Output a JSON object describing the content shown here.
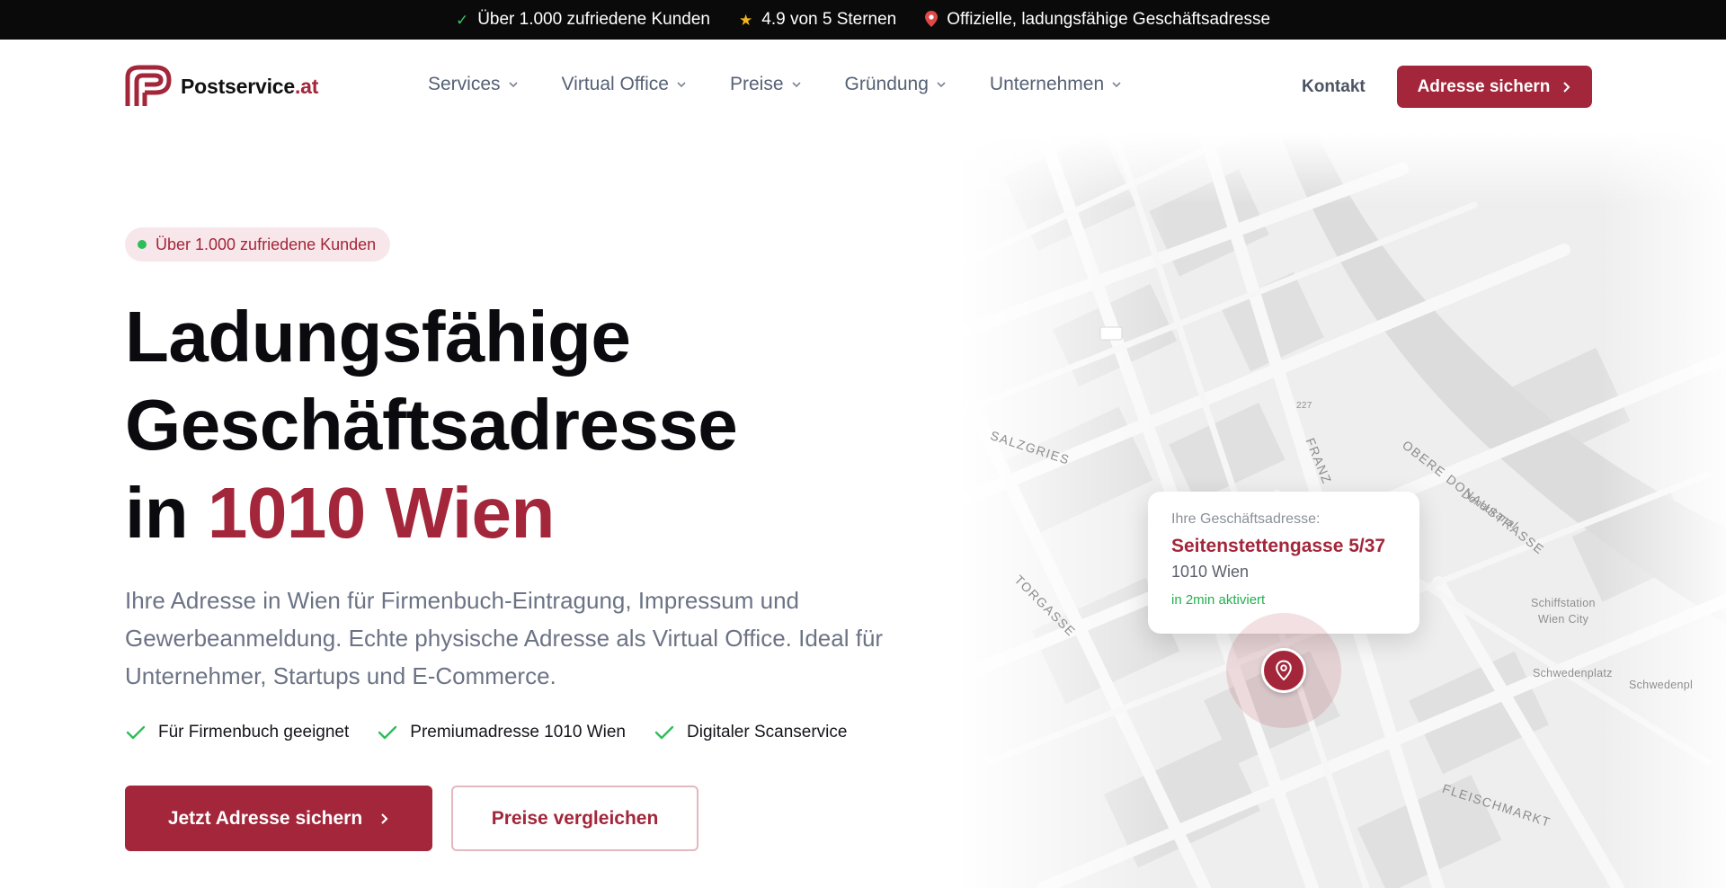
{
  "topbar": {
    "items": [
      {
        "icon": "check-icon",
        "text": "Über 1.000 zufriedene Kunden"
      },
      {
        "icon": "star-icon",
        "text": "4.9 von 5 Sternen"
      },
      {
        "icon": "pin-icon",
        "text": "Offizielle, ladungsfähige Geschäftsadresse"
      }
    ]
  },
  "header": {
    "logo": {
      "name": "Postservice",
      "tld": ".at"
    },
    "nav": [
      "Services",
      "Virtual Office",
      "Preise",
      "Gründung",
      "Unternehmen"
    ],
    "kontakt": "Kontakt",
    "cta": "Adresse sichern"
  },
  "hero": {
    "badge": "Über 1.000 zufriedene Kunden",
    "title_line1": "Ladungsfähige",
    "title_line2": "Geschäftsadresse",
    "title_line3_prefix": "in ",
    "title_line3_highlight": "1010 Wien",
    "description": "Ihre Adresse in Wien für Firmenbuch-Eintragung, Impressum und Gewerbeanmeldung. Echte physische Adresse als Virtual Office. Ideal für Unternehmer, Startups und E-Commerce.",
    "features": [
      "Für Firmenbuch geeignet",
      "Premiumadresse 1010 Wien",
      "Digitaler Scanservice"
    ],
    "primary_button": "Jetzt Adresse sichern",
    "secondary_button": "Preise vergleichen"
  },
  "map": {
    "street_labels": {
      "salzgries": "SALZGRIES",
      "franz": "FRANZ",
      "obere": "OBERE DONAUSTRASSE",
      "fleischmarkt": "FLEISCHMARKT",
      "torgasse": "TORGASSE",
      "donaukanal": "Donaukanal",
      "route": "227"
    },
    "poi_labels": {
      "schiffstation": "Schiffstation",
      "wien_city": "Wien City",
      "schwedenplatz": "Schwedenplatz",
      "schwedenplatz_right": "Schwedenpl"
    },
    "card": {
      "caption": "Ihre Geschäftsadresse:",
      "street": "Seitenstettengasse 5/37",
      "city": "1010 Wien",
      "status": "in 2min aktiviert"
    }
  },
  "colors": {
    "brand": "#a3263a",
    "topbar_bg": "#0a0a0a",
    "success": "#2fbd59",
    "star": "#f3b51d"
  }
}
